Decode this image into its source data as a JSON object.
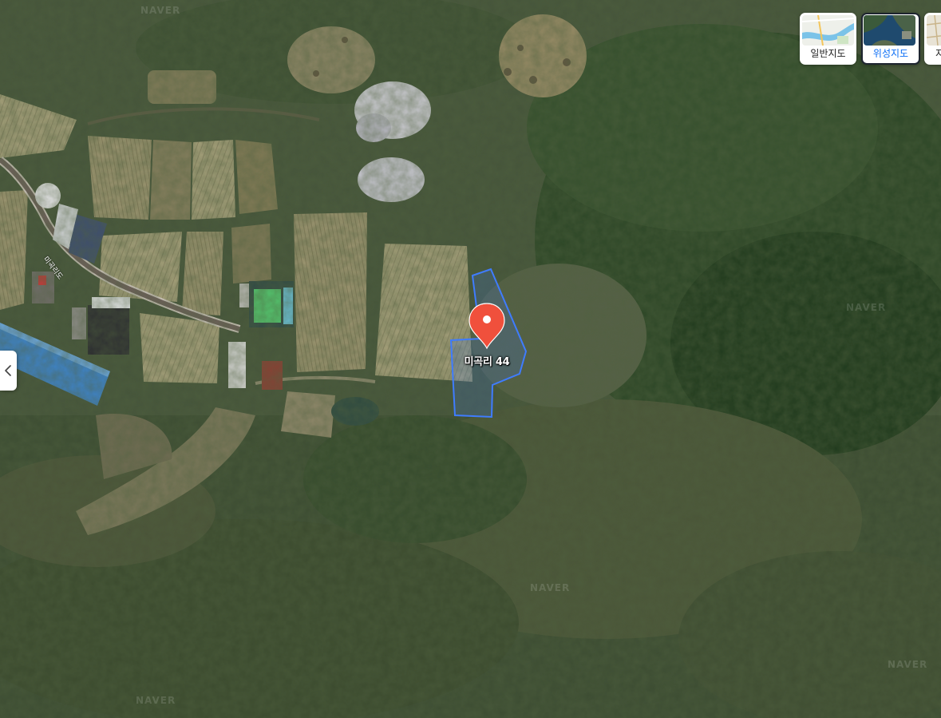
{
  "map": {
    "types": [
      {
        "label": "일반지도",
        "selected": false
      },
      {
        "label": "위성지도",
        "selected": true
      },
      {
        "label": "지",
        "selected": false
      }
    ],
    "marker": {
      "label": "미곡리 44",
      "icon": "map-pin-icon",
      "color": "#f0503c"
    },
    "parcel_outline_color": "#3f7cff",
    "road_label": "미곡리도",
    "watermark": "NAVER",
    "panel_toggle_icon": "chevron-left-icon"
  }
}
